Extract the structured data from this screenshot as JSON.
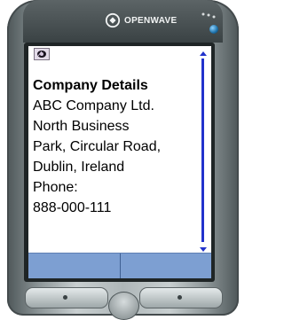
{
  "brand": {
    "name": "OPENWAVE"
  },
  "card": {
    "heading": "Company Details",
    "lines": [
      "ABC Company Ltd.",
      "North Business",
      "Park, Circular Road,",
      "Dublin, Ireland",
      "Phone:",
      "888-000-111"
    ]
  },
  "toolbar": {
    "icon": "back-icon"
  },
  "softkeys": {
    "left_label": "",
    "right_label": ""
  },
  "colors": {
    "softkey_bar": "#7d9fd2",
    "scroll_accent": "#2233cc"
  }
}
